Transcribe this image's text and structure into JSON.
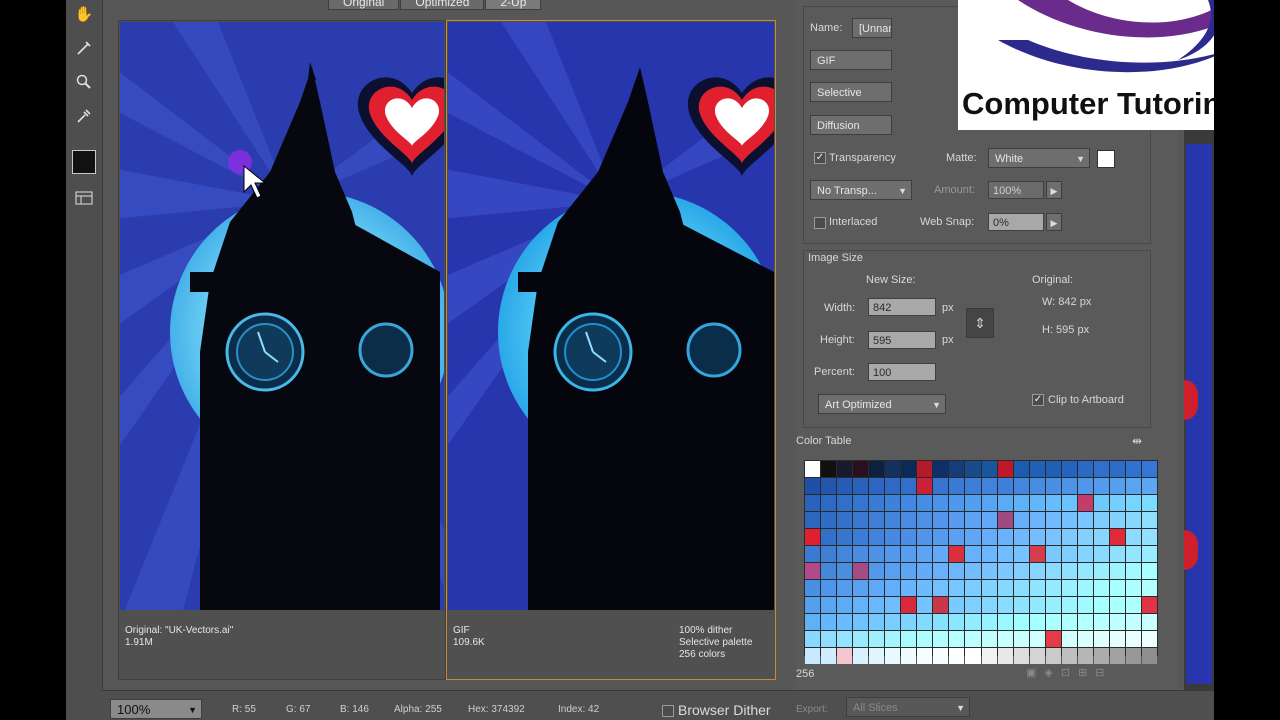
{
  "view_tabs": [
    "Original",
    "Optimized",
    "2-Up"
  ],
  "tools": [
    "hand-icon",
    "slice-select-icon",
    "zoom-icon",
    "eyedropper-icon",
    "color-swatch-icon",
    "toggle-slices-icon"
  ],
  "left_pane": {
    "line1": "Original: \"UK-Vectors.ai\"",
    "line2": "1.91M"
  },
  "right_pane": {
    "format": "GIF",
    "size": "109.6K",
    "dither": "100% dither",
    "palette": "Selective palette",
    "colors": "256 colors"
  },
  "preset": {
    "name_label": "Name:",
    "name_value": "[Unnamed]",
    "format": "GIF",
    "reduction": "Selective",
    "dither_algo": "Diffusion",
    "transparency_label": "Transparency",
    "matte_label": "Matte:",
    "matte_value": "White",
    "transparency_dither": "No Transp...",
    "amount_label": "Amount:",
    "amount_value": "100%",
    "interlaced_label": "Interlaced",
    "websnap_label": "Web Snap:",
    "websnap_value": "0%"
  },
  "image_size": {
    "title": "Image Size",
    "new_size_label": "New Size:",
    "original_label": "Original:",
    "width_label": "Width:",
    "width_value": "842",
    "height_label": "Height:",
    "height_value": "595",
    "unit": "px",
    "percent_label": "Percent:",
    "percent_value": "100",
    "orig_w": "W:  842 px",
    "orig_h": "H:  595 px",
    "quality": "Art Optimized",
    "clip_label": "Clip to Artboard"
  },
  "color_table": {
    "title": "Color Table",
    "count": "256",
    "cells": [
      "#ffffff",
      "#101010",
      "#1a1a2e",
      "#2a0f1e",
      "#0d2040",
      "#123060",
      "#0b2a55",
      "#b21b2c",
      "#0e2f6a",
      "#153d7a",
      "#184a8c",
      "#1a56a0",
      "#c0182a",
      "#1c5cb0",
      "#2060b8",
      "#1f5fb6",
      "#2463bf",
      "#2a6ac6",
      "#3070cc",
      "#2b6dc8",
      "#2f72d0",
      "#3477d6",
      "#1f4fa6",
      "#2456ad",
      "#275cb4",
      "#2a61ba",
      "#2d66c0",
      "#3069c4",
      "#336fca",
      "#c72236",
      "#3774d0",
      "#3a79d4",
      "#3d7ed8",
      "#4082dc",
      "#3f80da",
      "#4486de",
      "#478be2",
      "#4a8fe4",
      "#4d93e8",
      "#5097ea",
      "#539bec",
      "#569fee",
      "#59a3f0",
      "#5ca7f2",
      "#2a63bd",
      "#2e69c3",
      "#326fc9",
      "#3675cf",
      "#3a7bd5",
      "#3e81db",
      "#4287e1",
      "#468de5",
      "#4a93e9",
      "#4e99ed",
      "#529ff1",
      "#56a5f5",
      "#5aabf7",
      "#5eb1f9",
      "#62b7fb",
      "#66bdfd",
      "#6ac3fe",
      "#c43c6a",
      "#6ec9ff",
      "#72cfff",
      "#76d5ff",
      "#7adbff",
      "#2c66bf",
      "#316cc5",
      "#3672cb",
      "#3b78d1",
      "#407ed7",
      "#4584dd",
      "#4a8ae3",
      "#4f90e7",
      "#5496eb",
      "#599cef",
      "#5ea2f3",
      "#63a8f7",
      "#a04a82",
      "#68aefb",
      "#6db4fd",
      "#72baff",
      "#77c0ff",
      "#7cc6ff",
      "#81ccff",
      "#86d2ff",
      "#8bd8ff",
      "#90deff",
      "#e0202e",
      "#3370c8",
      "#3876ce",
      "#3d7cd4",
      "#4282da",
      "#4788e0",
      "#4c8ee6",
      "#5194ea",
      "#569aee",
      "#5ba0f2",
      "#60a6f6",
      "#65acfa",
      "#6ab2fe",
      "#6fb8ff",
      "#74beff",
      "#79c4ff",
      "#7ecaff",
      "#83d0ff",
      "#88d6ff",
      "#e02a3a",
      "#8ddcff",
      "#92e2ff",
      "#3a7ad0",
      "#3f80d6",
      "#4486dc",
      "#498ce2",
      "#4e92e8",
      "#5398ec",
      "#589ef0",
      "#5da4f4",
      "#62aaf8",
      "#d8303f",
      "#67b0fc",
      "#6cb6fe",
      "#71bcff",
      "#76c2ff",
      "#d33d4c",
      "#7bc8ff",
      "#80ceff",
      "#85d4ff",
      "#8adaff",
      "#8fe0ff",
      "#94e6ff",
      "#99ecff",
      "#b24a8a",
      "#4588da",
      "#4a8ee0",
      "#a64c84",
      "#5498ec",
      "#599ef0",
      "#5ea4f4",
      "#63aaf8",
      "#68b0fc",
      "#6db6fe",
      "#72bcff",
      "#77c2ff",
      "#7cc8ff",
      "#81ceff",
      "#86d4ff",
      "#8bdaff",
      "#90e0ff",
      "#95e6ff",
      "#9aecff",
      "#9ff2ff",
      "#a4f8ff",
      "#a9feff",
      "#4a90e2",
      "#4f96e8",
      "#549cee",
      "#59a2f2",
      "#5ea8f6",
      "#63aefa",
      "#68b4fe",
      "#6dbaff",
      "#72c0ff",
      "#77c6ff",
      "#7cccff",
      "#81d2ff",
      "#86d8ff",
      "#8bdeff",
      "#90e4ff",
      "#95eaff",
      "#9af0ff",
      "#9ff6ff",
      "#a4fcff",
      "#a9ffff",
      "#aeffff",
      "#b3ffff",
      "#55a0ee",
      "#5aa6f2",
      "#5facf6",
      "#64b2fa",
      "#69b8fe",
      "#6ebeff",
      "#d8293d",
      "#73c4ff",
      "#c8384a",
      "#78caff",
      "#7dd0ff",
      "#82d6ff",
      "#87dcff",
      "#8ce2ff",
      "#91e8ff",
      "#96eeff",
      "#9bf4ff",
      "#a0faff",
      "#a5ffff",
      "#aaffff",
      "#afffff",
      "#e03346",
      "#60b0f6",
      "#65b6fa",
      "#6abcfe",
      "#6fc2ff",
      "#74c8ff",
      "#79ceff",
      "#7ed4ff",
      "#83daff",
      "#88e0ff",
      "#8de6ff",
      "#92ecff",
      "#97f2ff",
      "#9cf8ff",
      "#a1feff",
      "#a6ffff",
      "#abffff",
      "#b0ffff",
      "#b5ffff",
      "#baffff",
      "#bfffff",
      "#c4ffff",
      "#c9ffff",
      "#8ad8ff",
      "#8fdeff",
      "#94e4ff",
      "#99eaff",
      "#9ef0ff",
      "#a3f6ff",
      "#a8fcff",
      "#adffff",
      "#b2ffff",
      "#b7ffff",
      "#bcffff",
      "#c1ffff",
      "#c6ffff",
      "#cbffff",
      "#d0ffff",
      "#e63a4a",
      "#d5ffff",
      "#daffff",
      "#dfffff",
      "#e4ffff",
      "#e9ffff",
      "#eeffff",
      "#c8eaff",
      "#d0eeff",
      "#f6c6d0",
      "#d8f2ff",
      "#e0f6ff",
      "#e8faff",
      "#f0fcff",
      "#f4fdff",
      "#f8feff",
      "#fbffff",
      "#ffffff",
      "#f2f2f2",
      "#e8e8e8",
      "#dedede",
      "#d4d4d4",
      "#cacaca",
      "#c0c0c0",
      "#b6b6b6",
      "#acacac",
      "#a2a2a2",
      "#989898",
      "#8e8e8e"
    ]
  },
  "status": {
    "zoom": "100%",
    "r": "R: 55",
    "g": "G: 67",
    "b": "B: 146",
    "alpha": "Alpha: 255",
    "hex": "Hex: 374392",
    "index": "Index: 42",
    "browser_dither": "Browser Dither",
    "export_label": "Export:",
    "export_value": "All Slices"
  },
  "logo": {
    "text": "Computer Tutoring"
  },
  "colors": {
    "sky": "#2b3cae",
    "sky_light": "#4157d0",
    "moon": "#6fd0f4",
    "tower": "#06070f",
    "heart": "#e0202e"
  }
}
